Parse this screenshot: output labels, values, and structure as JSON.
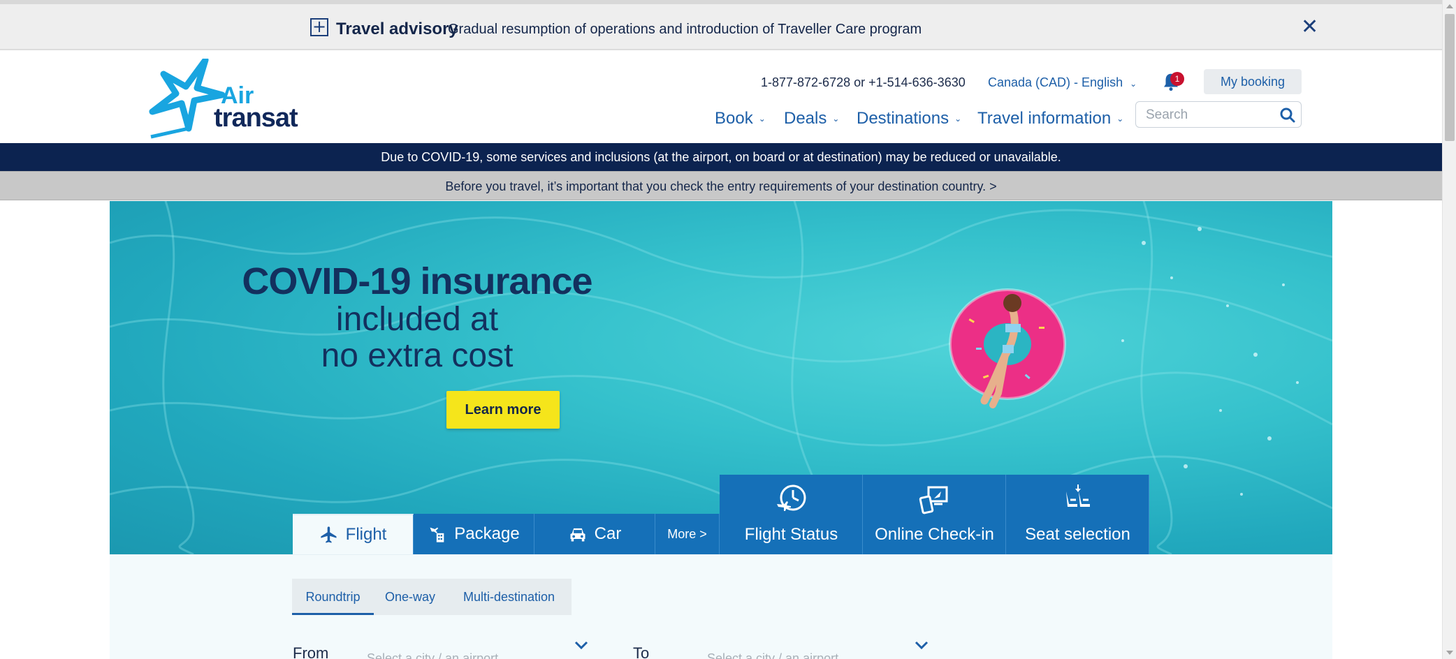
{
  "advisory": {
    "title": "Travel advisory",
    "text": "Gradual resumption of operations and introduction of Traveller Care program",
    "icons": {
      "expand": "plus-box-icon",
      "close": "close-icon"
    }
  },
  "header": {
    "logo": {
      "line1": "Air",
      "line2": "transat"
    },
    "phone": "1-877-872-6728 or +1-514-636-3630",
    "language": "Canada (CAD) - English",
    "notifications_count": "1",
    "my_booking": "My booking",
    "nav": [
      "Book",
      "Deals",
      "Destinations",
      "Travel information"
    ],
    "search_placeholder": "Search"
  },
  "notices": {
    "covid": "Due to COVID-19, some services and inclusions (at the airport, on board or at destination) may be reduced or unavailable.",
    "entry": "Before you travel, it’s important that you check the entry requirements of your destination country. >"
  },
  "hero": {
    "title": "COVID-19 insurance",
    "line2": "included at",
    "line3": "no extra cost",
    "cta": "Learn more"
  },
  "booking": {
    "tabs": [
      "Flight",
      "Package",
      "Car",
      "More >"
    ],
    "active_tab": "Flight",
    "tools": [
      "Flight Status",
      "Online Check-in",
      "Seat selection"
    ],
    "trip_types": [
      "Roundtrip",
      "One-way",
      "Multi-destination"
    ],
    "selected_trip": "Roundtrip",
    "from_label": "From",
    "to_label": "To",
    "from_placeholder": "Select a city / an airport",
    "to_placeholder": "Select a city / an airport"
  },
  "colors": {
    "brand_navy": "#0c2350",
    "brand_blue": "#1570b8",
    "logo_cyan": "#19a5e0",
    "cta_yellow": "#f5e51b",
    "badge_red": "#c8102e"
  }
}
